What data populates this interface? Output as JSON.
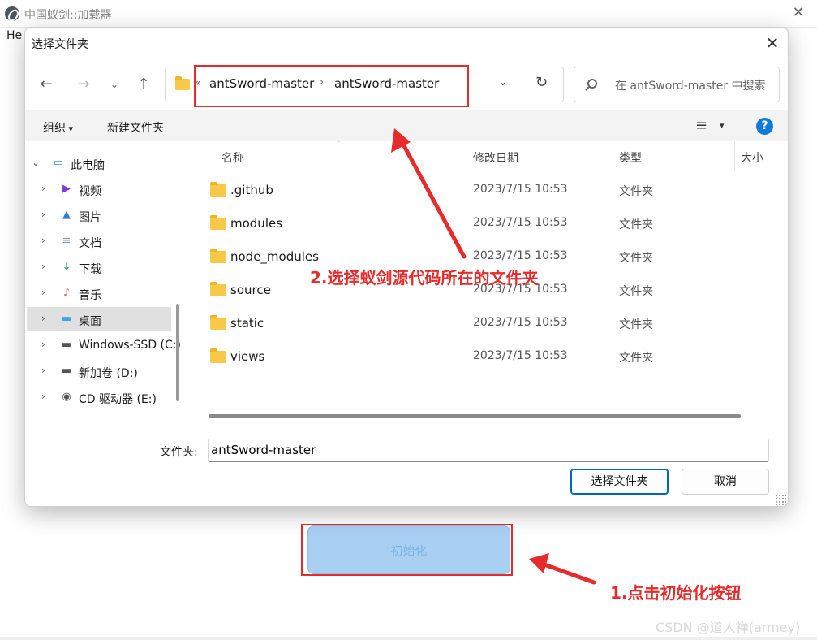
{
  "background_window": {
    "title": "中国蚁剑::加载器",
    "close_glyph": "✕",
    "menu_text": "He",
    "init_button_label": "初始化"
  },
  "dialog": {
    "title": "选择文件夹",
    "close_glyph": "✕",
    "nav": {
      "back": "←",
      "forward": "→",
      "recent": "⌄",
      "up": "↑"
    },
    "address": {
      "overflow": "«",
      "crumbs": [
        "antSword-master",
        "antSword-master"
      ],
      "separator": "›",
      "dropdown": "⌄",
      "refresh": "↻"
    },
    "search": {
      "placeholder": "在 antSword-master 中搜索"
    },
    "toolbar": {
      "organize": "组织",
      "new_folder": "新建文件夹",
      "view": "≡",
      "view_dd": "▾",
      "help": "?"
    },
    "nav_pane": [
      {
        "label": "此电脑",
        "icon": "pc-icon",
        "glyph": "▭",
        "color": "#2b9be0",
        "expanded": true
      },
      {
        "label": "视频",
        "icon": "video-icon",
        "glyph": "▶",
        "color": "#7b3fc9"
      },
      {
        "label": "图片",
        "icon": "pictures-icon",
        "glyph": "▲",
        "color": "#2a7fd4"
      },
      {
        "label": "文档",
        "icon": "documents-icon",
        "glyph": "≡",
        "color": "#8a99aa"
      },
      {
        "label": "下载",
        "icon": "download-icon",
        "glyph": "↓",
        "color": "#1a9e6e"
      },
      {
        "label": "音乐",
        "icon": "music-icon",
        "glyph": "♪",
        "color": "#e86a5c"
      },
      {
        "label": "桌面",
        "icon": "desktop-icon",
        "glyph": "▬",
        "color": "#3aa8e0",
        "selected": true
      },
      {
        "label": "Windows-SSD (C:)",
        "icon": "drive-c-icon",
        "glyph": "▬",
        "color": "#555555"
      },
      {
        "label": "新加卷 (D:)",
        "icon": "drive-d-icon",
        "glyph": "▬",
        "color": "#555555"
      },
      {
        "label": "CD 驱动器 (E:)",
        "icon": "cd-drive-icon",
        "glyph": "◉",
        "color": "#555555"
      }
    ],
    "columns": {
      "name": "名称",
      "date": "修改日期",
      "type": "类型",
      "size": "大小"
    },
    "files": [
      {
        "name": ".github",
        "date": "2023/7/15 10:53",
        "type": "文件夹"
      },
      {
        "name": "modules",
        "date": "2023/7/15 10:53",
        "type": "文件夹"
      },
      {
        "name": "node_modules",
        "date": "2023/7/15 10:53",
        "type": "文件夹"
      },
      {
        "name": "source",
        "date": "2023/7/15 10:53",
        "type": "文件夹"
      },
      {
        "name": "static",
        "date": "2023/7/15 10:53",
        "type": "文件夹"
      },
      {
        "name": "views",
        "date": "2023/7/15 10:53",
        "type": "文件夹"
      }
    ],
    "folder_label": "文件夹:",
    "folder_value": "antSword-master",
    "select_button": "选择文件夹",
    "cancel_button": "取消"
  },
  "annotations": {
    "step2": "2.选择蚁剑源代码所在的文件夹",
    "step1": "1.点击初始化按钮",
    "color": "#e52b2b"
  },
  "watermark": "CSDN @道人禅(armey)"
}
